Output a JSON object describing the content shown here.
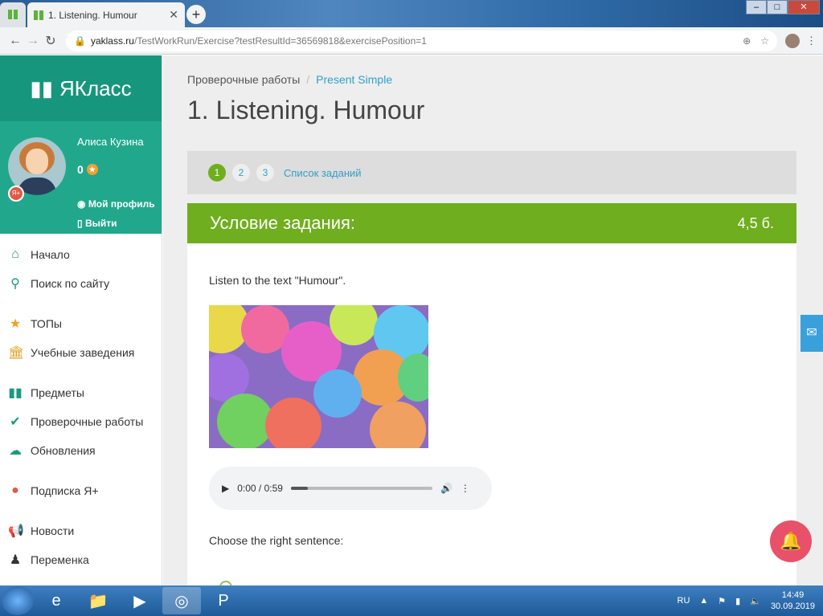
{
  "browser": {
    "tab_title": "1. Listening. Humour",
    "url_domain": "yaklass.ru",
    "url_path": "/TestWorkRun/Exercise?testResultId=36569818&exercisePosition=1"
  },
  "sidebar": {
    "logo": "ЯКласс",
    "user_name": "Алиса Кузина",
    "score": "0",
    "profile": "Мой профиль",
    "logout": "Выйти",
    "badge": "Я+",
    "items": [
      {
        "label": "Начало",
        "icon": "home-icon"
      },
      {
        "label": "Поиск по сайту",
        "icon": "search-icon"
      },
      {
        "label": "ТОПы",
        "icon": "star-icon"
      },
      {
        "label": "Учебные заведения",
        "icon": "institution-icon"
      },
      {
        "label": "Предметы",
        "icon": "book-icon"
      },
      {
        "label": "Проверочные работы",
        "icon": "check-circle-icon"
      },
      {
        "label": "Обновления",
        "icon": "cloud-icon"
      },
      {
        "label": "Подписка Я+",
        "icon": "subscription-icon"
      },
      {
        "label": "Новости",
        "icon": "megaphone-icon"
      },
      {
        "label": "Переменка",
        "icon": "person-icon"
      }
    ]
  },
  "main": {
    "breadcrumb": {
      "parent": "Проверочные работы",
      "current": "Present Simple"
    },
    "title": "1. Listening. Humour",
    "steps": [
      "1",
      "2",
      "3"
    ],
    "task_list": "Список заданий",
    "condition": "Условие задания:",
    "points": "4,5 б.",
    "instruction": "Listen to the text \"Humour\".",
    "audio": {
      "time": "0:00 / 0:59",
      "progress": 0.12
    },
    "question": "Choose the right sentence:"
  },
  "taskbar": {
    "lang": "RU",
    "time": "14:49",
    "date": "30.09.2019"
  },
  "colors": {
    "green": "#6fae1e",
    "teal": "#21a88c",
    "link": "#2ea0c8"
  }
}
